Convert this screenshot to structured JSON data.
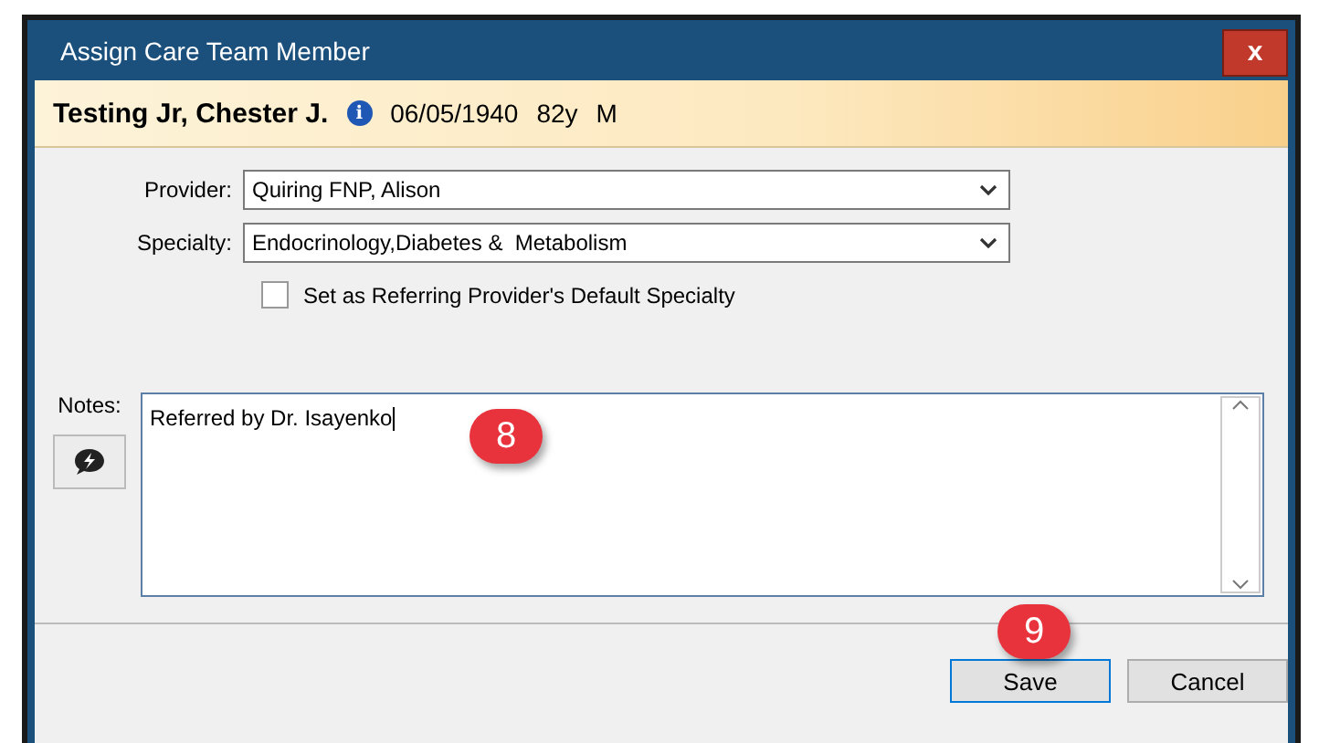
{
  "window": {
    "title": "Assign Care Team Member",
    "close": "x"
  },
  "patient": {
    "name": "Testing Jr, Chester J.",
    "info": "i",
    "dob": "06/05/1940",
    "age": "82y",
    "sex": "M"
  },
  "fields": [
    {
      "label": "Provider:",
      "value": "Quiring FNP, Alison"
    },
    {
      "label": "Specialty:",
      "value": "Endocrinology,Diabetes &  Metabolism"
    }
  ],
  "default_specialty": {
    "label": "Set as Referring Provider's Default Specialty",
    "checked": false
  },
  "notes": {
    "label": "Notes:",
    "value": "Referred by Dr. Isayenko"
  },
  "callouts": [
    {
      "text": "8"
    },
    {
      "text": "9"
    }
  ],
  "buttons": [
    {
      "label": "Save",
      "selected": true
    },
    {
      "label": "Cancel",
      "selected": false
    }
  ]
}
